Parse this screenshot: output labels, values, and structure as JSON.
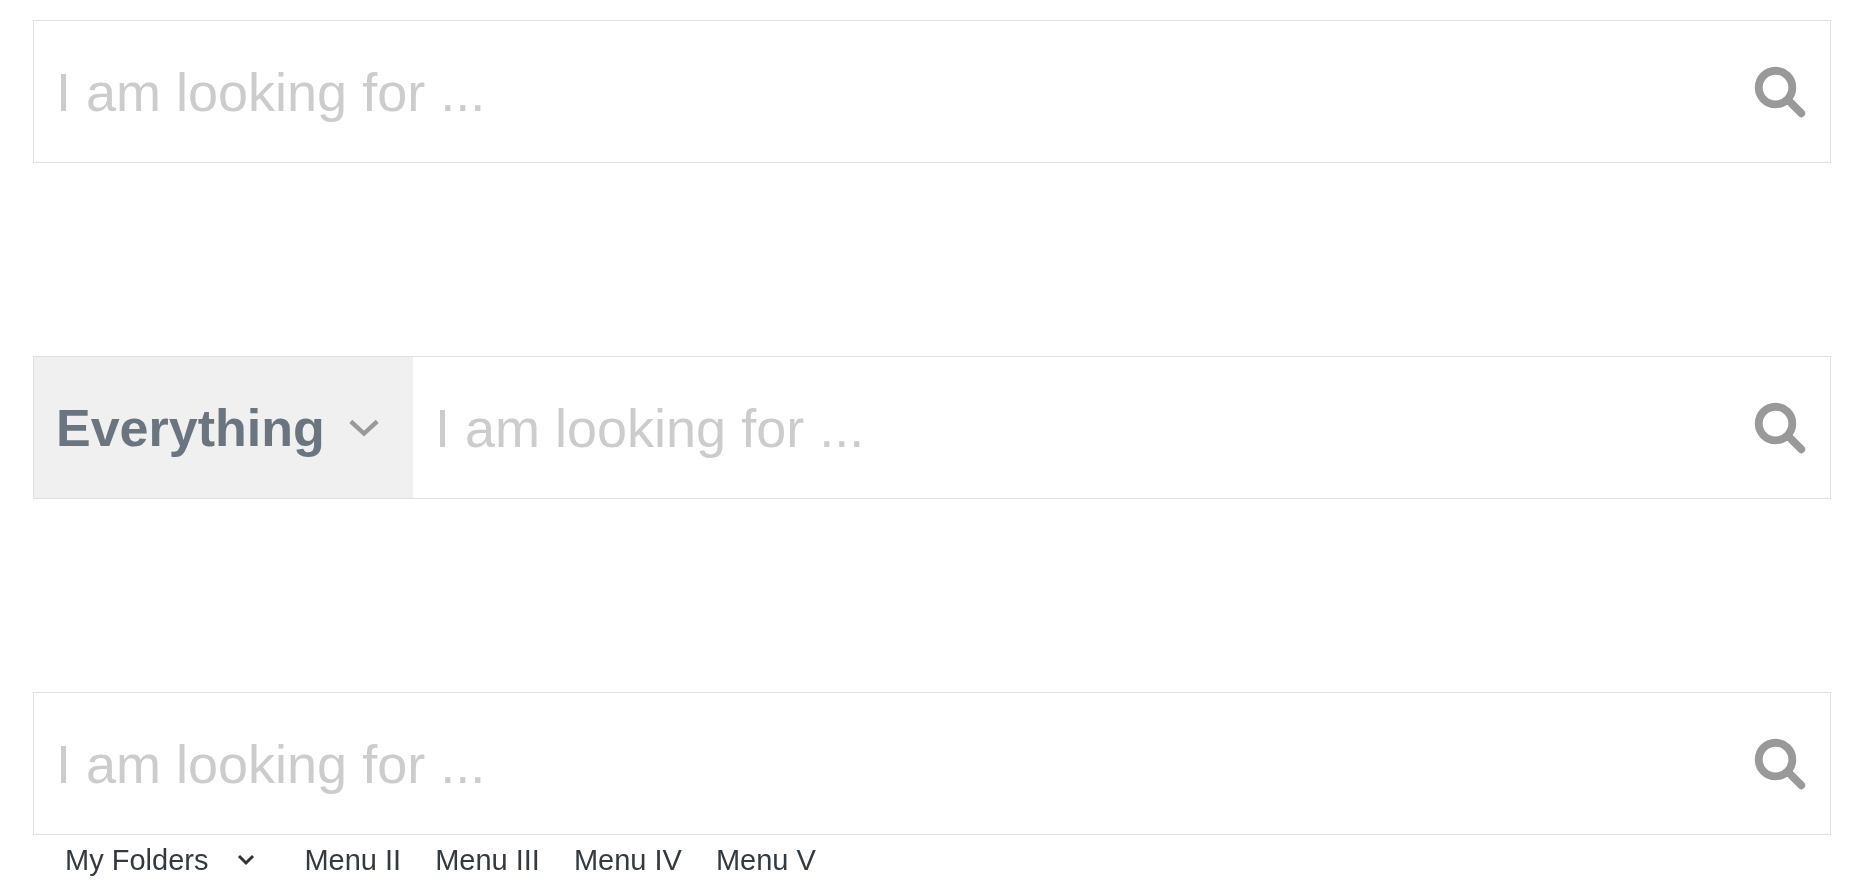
{
  "search_bars": [
    {
      "kind": "plain",
      "placeholder": "I am looking for ..."
    },
    {
      "kind": "scoped",
      "scope": "Everything",
      "placeholder": "I am looking for ..."
    },
    {
      "kind": "plain",
      "placeholder": "I am looking for ..."
    }
  ],
  "menu": [
    {
      "kind": "dropdown",
      "label": "My Folders"
    },
    {
      "kind": "link",
      "label": "Menu II"
    },
    {
      "kind": "link",
      "label": "Menu III"
    },
    {
      "kind": "link",
      "label": "Menu IV"
    },
    {
      "kind": "link",
      "label": "Menu V"
    }
  ]
}
